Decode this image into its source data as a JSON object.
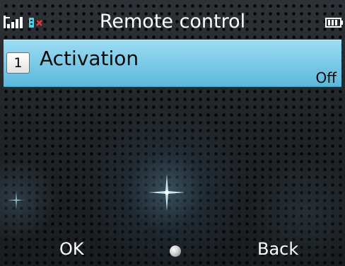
{
  "status_bar": {
    "signal_icon": "signal-strength-icon",
    "network_icon": "network-indicator-icon",
    "battery_icon": "battery-icon",
    "title": "Remote control"
  },
  "list": {
    "items": [
      {
        "number": "1",
        "label": "Activation",
        "value": "Off",
        "selected": true
      }
    ]
  },
  "softkeys": {
    "left_label": "OK",
    "center_icon": "center-select-icon",
    "right_label": "Back"
  },
  "colors": {
    "highlight": "#7fcbe8",
    "background": "#1e2124",
    "text_light": "#ffffff",
    "text_dark": "#0a0a0a"
  }
}
